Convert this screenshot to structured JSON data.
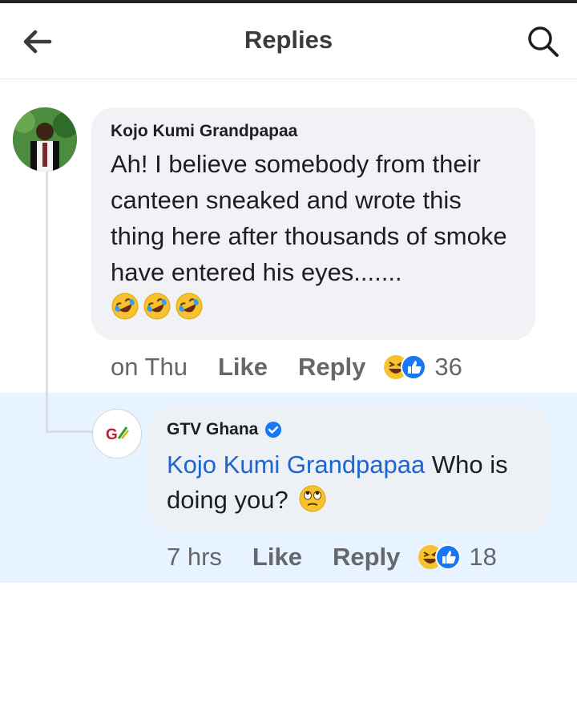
{
  "header": {
    "title": "Replies",
    "back_icon": "arrow-left-icon",
    "search_icon": "search-icon"
  },
  "comments": [
    {
      "author": "Kojo Kumi Grandpapaa",
      "text": "Ah! I believe somebody from their canteen sneaked and wrote this thing here after thousands of smoke have entered his eyes.......",
      "emojis": [
        "rolling-laughing-emoji",
        "rolling-laughing-emoji",
        "rolling-laughing-emoji"
      ],
      "time": "on Thu",
      "like_label": "Like",
      "reply_label": "Reply",
      "reaction_count": "36"
    },
    {
      "author": "GTV Ghana",
      "verified": true,
      "avatar_logo_text": "G",
      "mention": "Kojo Kumi Grandpapaa",
      "text_line1": " Who is",
      "text_line2": "doing you?",
      "emoji": "eye-roll-emoji",
      "time": "7 hrs",
      "like_label": "Like",
      "reply_label": "Reply",
      "reaction_count": "18"
    }
  ],
  "colors": {
    "mention": "#1b66d2",
    "highlight": "#e7f3ff",
    "bubble": "#f0f2f5",
    "like_blue": "#1877f2",
    "haha_yellow": "#f7c22d"
  }
}
